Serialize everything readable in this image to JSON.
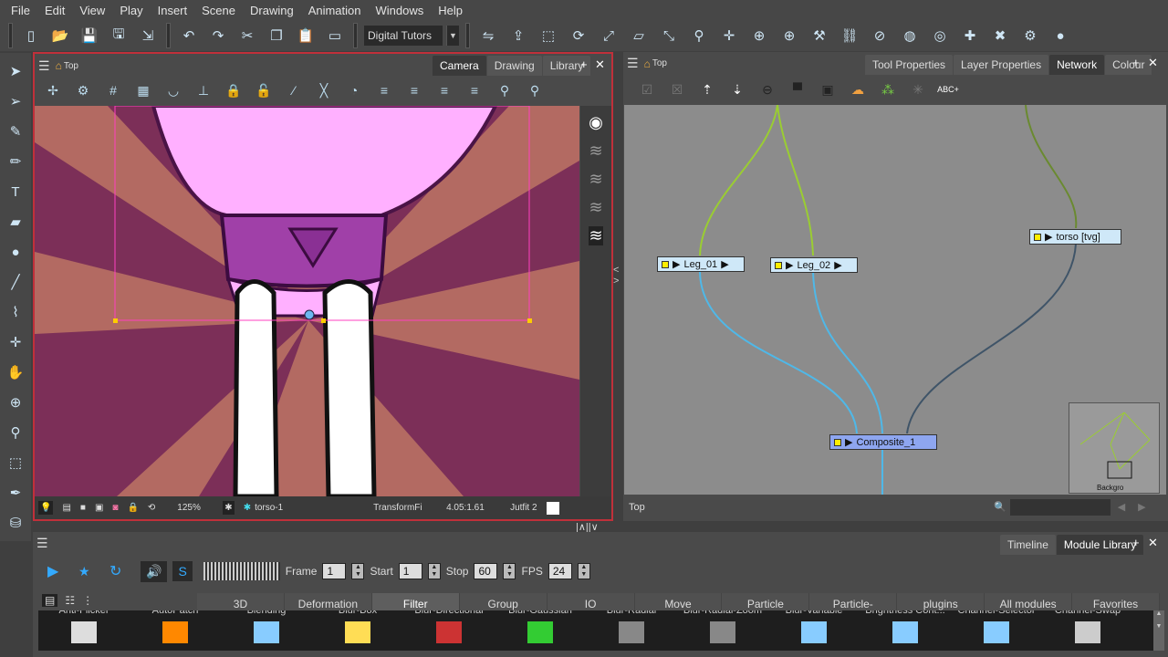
{
  "menu": [
    "File",
    "Edit",
    "View",
    "Play",
    "Insert",
    "Scene",
    "Drawing",
    "Animation",
    "Windows",
    "Help"
  ],
  "toolbar": {
    "workspace": "Digital Tutors",
    "file_icons": [
      "new-scene-icon",
      "open-icon",
      "save-icon",
      "save-as-icon",
      "import-icon"
    ],
    "edit_icons": [
      "undo-icon",
      "redo-icon",
      "cut-icon",
      "copy-icon",
      "paste-icon",
      "keyboard-icon"
    ],
    "right_icons": [
      "flip-icon",
      "export-icon",
      "transform-icon",
      "rotate-icon",
      "scale-icon",
      "skew-icon",
      "maximize-icon",
      "bone-icon",
      "pivot-icon",
      "peg-icon",
      "peg-icon",
      "hammer-icon",
      "link-icon",
      "disable-icon",
      "onion-icon",
      "onion-skin-icon",
      "add-keyframe-icon",
      "remove-keyframe-icon",
      "settings-icon",
      "apple-icon"
    ]
  },
  "left_tools": [
    "select-icon",
    "contour-editor-icon",
    "brush-icon",
    "pencil-icon",
    "text-icon",
    "eraser-icon",
    "paint-icon",
    "line-icon",
    "dropper-icon",
    "pivot-icon",
    "hand-icon",
    "zoom-icon",
    "bone-icon",
    "transform-icon",
    "pen-icon",
    "bucket-icon"
  ],
  "camera_panel": {
    "breadcrumb": "Top",
    "tabs": [
      "Camera",
      "Drawing",
      "Library"
    ],
    "active_tab": "Camera",
    "status": {
      "zoom": "125%",
      "layer": "torso-1",
      "tool": "TransformFi",
      "coords": "4.05:1.61",
      "outfit": "Jutfit 2"
    }
  },
  "network_panel": {
    "breadcrumb": "Top",
    "tabs": [
      "Tool Properties",
      "Layer Properties",
      "Network",
      "Colour"
    ],
    "active_tab": "Network",
    "nodes": [
      "Leg_01",
      "Leg_02",
      "torso [tvg]",
      "Composite_1"
    ],
    "footer": "Top",
    "minimap_label": "Backgro"
  },
  "timeline": {
    "tabs": [
      "Timeline",
      "Module Library"
    ],
    "active_tab": "Module Library",
    "frame_label": "Frame",
    "frame": "1",
    "start_label": "Start",
    "start": "1",
    "stop_label": "Stop",
    "stop": "60",
    "fps_label": "FPS",
    "fps": "24"
  },
  "module_library": {
    "categories": [
      "3D",
      "Deformation",
      "Filter",
      "Group",
      "IO",
      "Move",
      "Particle",
      "Particle-Examples",
      "plugins",
      "All modules",
      "Favorites"
    ],
    "active": "Filter",
    "modules": [
      "Anti-Flicker",
      "AutoPatch",
      "Blending",
      "Blur-Box",
      "Blur-Directional",
      "Blur-Gaussian",
      "Blur-Radial",
      "Blur-Radial-Zoom",
      "Blur-Variable",
      "Brightness Cont...",
      "Channel-Selector",
      "Channel-Swap"
    ]
  },
  "colors": {
    "selected_panel_border": "#c0303a",
    "node_fill": "#cfe8f8",
    "composite_fill": "#8ea6f0",
    "wire_green": "#9acd32",
    "wire_blue": "#4fb8e8"
  }
}
